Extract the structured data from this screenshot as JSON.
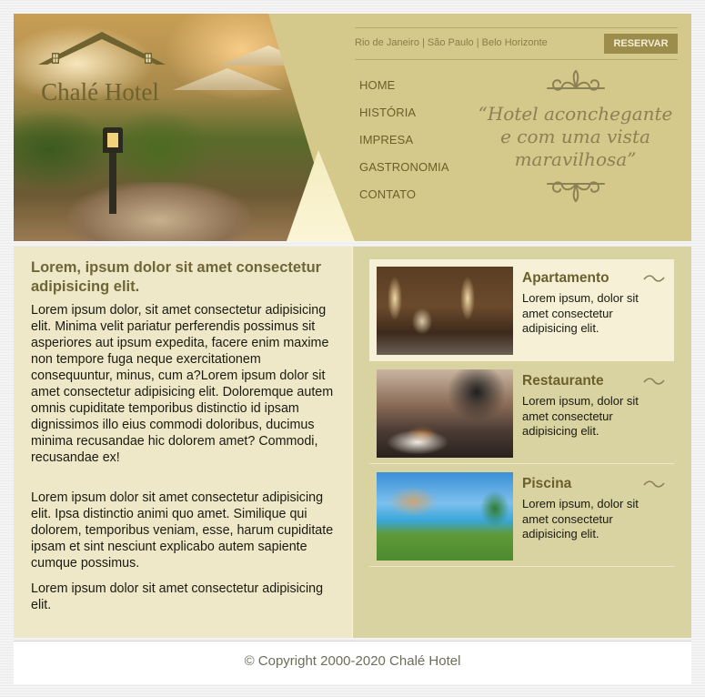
{
  "brand": {
    "name": "Chalé Hotel"
  },
  "header": {
    "cities": "Rio de Janeiro | São Paulo | Belo Horizonte",
    "reserve_label": "RESERVAR",
    "nav": [
      {
        "label": "HOME"
      },
      {
        "label": "HISTÓRIA"
      },
      {
        "label": "IMPRESA"
      },
      {
        "label": "GASTRONOMIA"
      },
      {
        "label": "CONTATO"
      }
    ],
    "quote_lines": [
      "“Hotel aconchegante",
      "e com uma vista",
      "maravilhosa”"
    ]
  },
  "main": {
    "heading": "Lorem, ipsum dolor sit amet consectetur adipisicing elit.",
    "paragraphs": [
      "Lorem ipsum dolor, sit amet consectetur adipisicing elit. Minima velit pariatur perferendis possimus sit asperiores aut ipsum expedita, facere enim maxime non tempore fuga neque exercitationem consequuntur, minus, cum a?Lorem ipsum dolor sit amet consectetur adipisicing elit. Doloremque autem omnis cupiditate temporibus distinctio id ipsam dignissimos illo eius commodi doloribus, ducimus minima recusandae hic dolorem amet? Commodi, recusandae ex!",
      "Lorem ipsum dolor sit amet consectetur adipisicing elit. Ipsa distinctio animi quo amet. Similique qui dolorem, temporibus veniam, esse, harum cupiditate ipsam et sint nesciunt explicabo autem sapiente cumque possimus.",
      "Lorem ipsum dolor sit amet consectetur adipisicing elit."
    ],
    "cards": [
      {
        "title": "Apartamento",
        "text": "Lorem ipsum, dolor sit amet consectetur adipisicing elit."
      },
      {
        "title": "Restaurante",
        "text": "Lorem ipsum, dolor sit amet consectetur adipisicing elit."
      },
      {
        "title": "Piscina",
        "text": "Lorem ipsum, dolor sit amet consectetur adipisicing elit."
      }
    ]
  },
  "footer": {
    "copyright": "© Copyright 2000-2020 Chalé Hotel"
  },
  "colors": {
    "gold": "#d4c98a",
    "dark_gold": "#9c8d4d",
    "text_olive": "#6f6536",
    "cream": "#eee8c8",
    "khaki": "#d9d2a1"
  }
}
